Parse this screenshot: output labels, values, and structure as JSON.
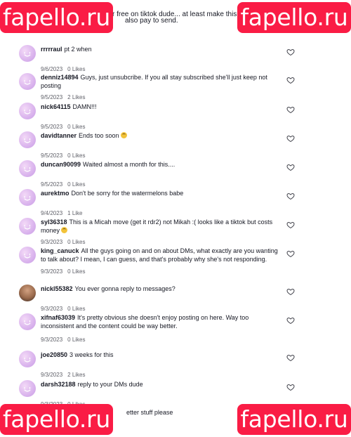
{
  "top_partial": {
    "line1": "ke this for free on tiktok dude... at least make this",
    "line2": "also pay to send.",
    "line3": ""
  },
  "comments": [
    {
      "user": "rrrrraul",
      "text": "pt 2 when",
      "date": "9/6/2023",
      "likes": "0 Likes",
      "emoji": false,
      "avatar": "default"
    },
    {
      "user": "denniz14894",
      "text": "Guys, just unsubcribe. If you all stay subscribed she'll just keep not posting",
      "date": "9/5/2023",
      "likes": "2 Likes",
      "emoji": false,
      "avatar": "default"
    },
    {
      "user": "nick64115",
      "text": "DAMN!!!",
      "date": "9/5/2023",
      "likes": "0 Likes",
      "emoji": false,
      "avatar": "default"
    },
    {
      "user": "davidtanner",
      "text": "Ends too soon",
      "date": "9/5/2023",
      "likes": "0 Likes",
      "emoji": true,
      "avatar": "default"
    },
    {
      "user": "duncan90099",
      "text": "Waited almost a month for this....",
      "date": "9/5/2023",
      "likes": "0 Likes",
      "emoji": false,
      "avatar": "default"
    },
    {
      "user": "aurektmo",
      "text": "Don't be sorry for the watermelons babe",
      "date": "9/4/2023",
      "likes": "1 Like",
      "emoji": false,
      "avatar": "default"
    },
    {
      "user": "syl36318",
      "text": "This is a Micah move (get it rdr2) not Mikah :( looks like a tiktok but costs money",
      "date": "9/3/2023",
      "likes": "0 Likes",
      "emoji": true,
      "avatar": "default"
    },
    {
      "user": "king_canuck",
      "text": "All the guys going on and on about DMs, what exactly are you wanting to talk about? I mean, I can guess, and that's probably why she's not responding.",
      "date": "9/3/2023",
      "likes": "0 Likes",
      "emoji": false,
      "avatar": "default"
    },
    {
      "user": "nickl55382",
      "text": "You ever gonna reply to messages?",
      "date": "9/3/2023",
      "likes": "0 Likes",
      "emoji": false,
      "avatar": "photo"
    },
    {
      "user": "xifnaf63039",
      "text": "It's pretty obvious she doesn't enjoy posting on here. Way too inconsistent and the content could be way better.",
      "date": "9/3/2023",
      "likes": "0 Likes",
      "emoji": false,
      "avatar": "default"
    },
    {
      "user": "joe20850",
      "text": "3 weeks for this",
      "date": "9/3/2023",
      "likes": "2 Likes",
      "emoji": false,
      "avatar": "default"
    },
    {
      "user": "darsh32188",
      "text": "reply to your DMs dude",
      "date": "9/3/2023",
      "likes": "0 Likes",
      "emoji": false,
      "avatar": "default"
    }
  ],
  "bottom_partial": {
    "text": "etter stuff please"
  },
  "watermark": {
    "text": "fapello.ru",
    "color": "#fa1c45"
  },
  "icons": {
    "heart": "heart-outline-icon",
    "avatar": "smiley-avatar-icon"
  }
}
